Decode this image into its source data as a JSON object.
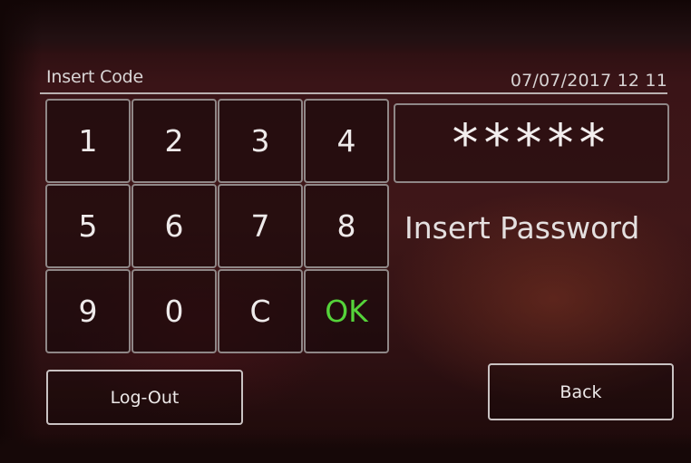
{
  "header": {
    "title": "Insert Code",
    "datetime": "07/07/2017 12 11"
  },
  "keypad": {
    "keys": [
      "1",
      "2",
      "3",
      "4",
      "5",
      "6",
      "7",
      "8",
      "9",
      "0",
      "C",
      "OK"
    ]
  },
  "password": {
    "masked_value": "*****",
    "label": "Insert Password"
  },
  "buttons": {
    "logout_label": "Log-Out",
    "back_label": "Back"
  },
  "colors": {
    "ok_key": "#55d33a",
    "background": "#3f1718",
    "border": "#8f8787"
  }
}
